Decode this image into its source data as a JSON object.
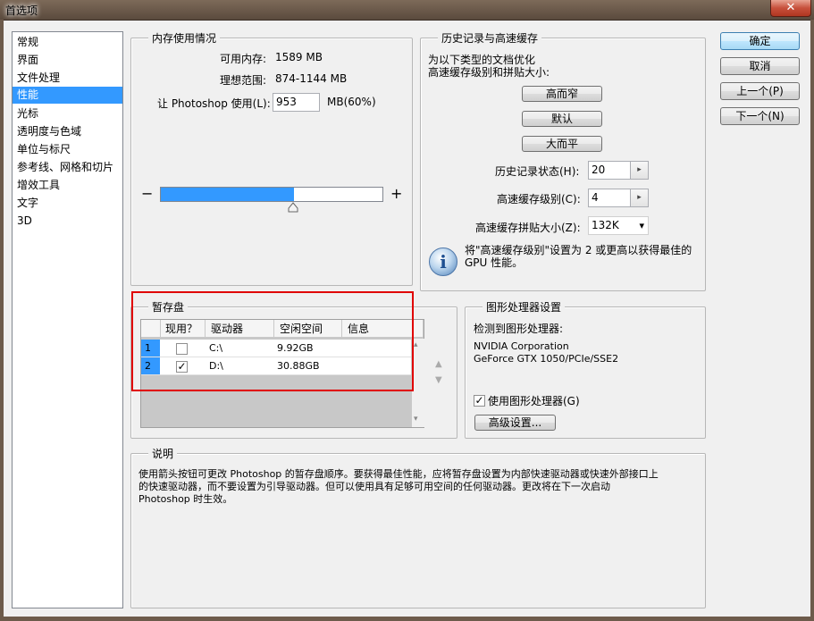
{
  "window": {
    "title": "首选项",
    "close_glyph": "✕"
  },
  "sidebar": {
    "items": [
      {
        "label": "常规"
      },
      {
        "label": "界面"
      },
      {
        "label": "文件处理"
      },
      {
        "label": "性能",
        "selected": true
      },
      {
        "label": "光标"
      },
      {
        "label": "透明度与色域"
      },
      {
        "label": "单位与标尺"
      },
      {
        "label": "参考线、网格和切片"
      },
      {
        "label": "增效工具"
      },
      {
        "label": "文字"
      },
      {
        "label": "3D"
      }
    ]
  },
  "memory": {
    "legend": "内存使用情况",
    "available_label": "可用内存:",
    "available_value": "1589 MB",
    "ideal_label": "理想范围:",
    "ideal_value": "874-1144 MB",
    "let_label": "让 Photoshop 使用(L):",
    "let_value": "953",
    "let_suffix": "MB(60%)",
    "minus": "−",
    "plus": "+",
    "slider_percent": 60
  },
  "history": {
    "legend": "历史记录与高速缓存",
    "desc_line1": "为以下类型的文档优化",
    "desc_line2": "高速缓存级别和拼贴大小:",
    "btn_tall_thin": "高而窄",
    "btn_default": "默认",
    "btn_big_flat": "大而平",
    "states_label": "历史记录状态(H):",
    "states_value": "20",
    "cache_levels_label": "高速缓存级别(C):",
    "cache_levels_value": "4",
    "tile_size_label": "高速缓存拼贴大小(Z):",
    "tile_size_value": "132K",
    "info_line1": "将\"高速缓存级别\"设置为 2 或更高以获得最佳的",
    "info_line2": "GPU 性能。",
    "info_glyph": "i",
    "spin_glyph": "▸",
    "dropdown_glyph": "▾"
  },
  "scratch": {
    "legend": "暂存盘",
    "columns": [
      "现用？",
      "驱动器",
      "空闲空间",
      "信息"
    ],
    "rows": [
      {
        "num": "1",
        "active": false,
        "drive": "C:\\",
        "free": "9.92GB",
        "info": ""
      },
      {
        "num": "2",
        "active": true,
        "drive": "D:\\",
        "free": "30.88GB",
        "info": ""
      }
    ],
    "check_glyph": "✓",
    "up_glyph": "▲",
    "down_glyph": "▼",
    "scroll_up": "▴",
    "scroll_down": "▾"
  },
  "gpu": {
    "legend": "图形处理器设置",
    "detected_label": "检测到图形处理器:",
    "vendor": "NVIDIA Corporation",
    "model": "GeForce GTX 1050/PCIe/SSE2",
    "use_gpu_label": "使用图形处理器(G)",
    "use_gpu_checked": true,
    "advanced_button": "高级设置..."
  },
  "description": {
    "legend": "说明",
    "line1": "使用箭头按钮可更改 Photoshop 的暂存盘顺序。要获得最佳性能，应将暂存盘设置为内部快速驱动器或快速外部接口上",
    "line2": "的快速驱动器，而不要设置为引导驱动器。但可以使用具有足够可用空间的任何驱动器。更改将在下一次启动",
    "line3": "Photoshop 时生效。"
  },
  "actions": {
    "ok": "确定",
    "cancel": "取消",
    "prev": "上一个(P)",
    "next": "下一个(N)"
  },
  "colors": {
    "selection": "#3399ff",
    "highlight_box": "#e00000",
    "dialog_bg": "#f0f0f0"
  }
}
